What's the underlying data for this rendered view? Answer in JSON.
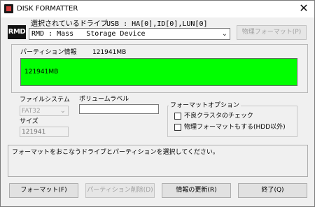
{
  "window": {
    "title": "DISK FORMATTER",
    "close_glyph": "✕"
  },
  "drive": {
    "logo_text": "RMD",
    "selected_label": "選択されているドライブ",
    "usb_info": "USB : HA[0],ID[0],LUN[0]",
    "selected_value": "RMD : Mass   Storage Device",
    "physical_format_button": "物理フォーマット(P)"
  },
  "partition": {
    "label": "パーティション情報",
    "size_label": "121941MB",
    "bar_text": "121941MB",
    "bar_color": "#00ff00"
  },
  "filesystem": {
    "label": "ファイルシステム",
    "value": "FAT32",
    "size_label": "サイズ",
    "size_value": "121941"
  },
  "volume": {
    "label": "ボリュームラベル",
    "value": ""
  },
  "format_options": {
    "legend": "フォーマットオプション",
    "option1": "不良クラスタのチェック",
    "option2": "物理フォーマットもする(HDD以外)"
  },
  "status": {
    "message": "フォーマットをおこなうドライブとパーティションを選択してください。"
  },
  "buttons": {
    "format": "フォーマット(F)",
    "delete_partition": "パーティション削除(D)",
    "refresh": "情報の更新(R)",
    "exit": "終了(Q)"
  }
}
